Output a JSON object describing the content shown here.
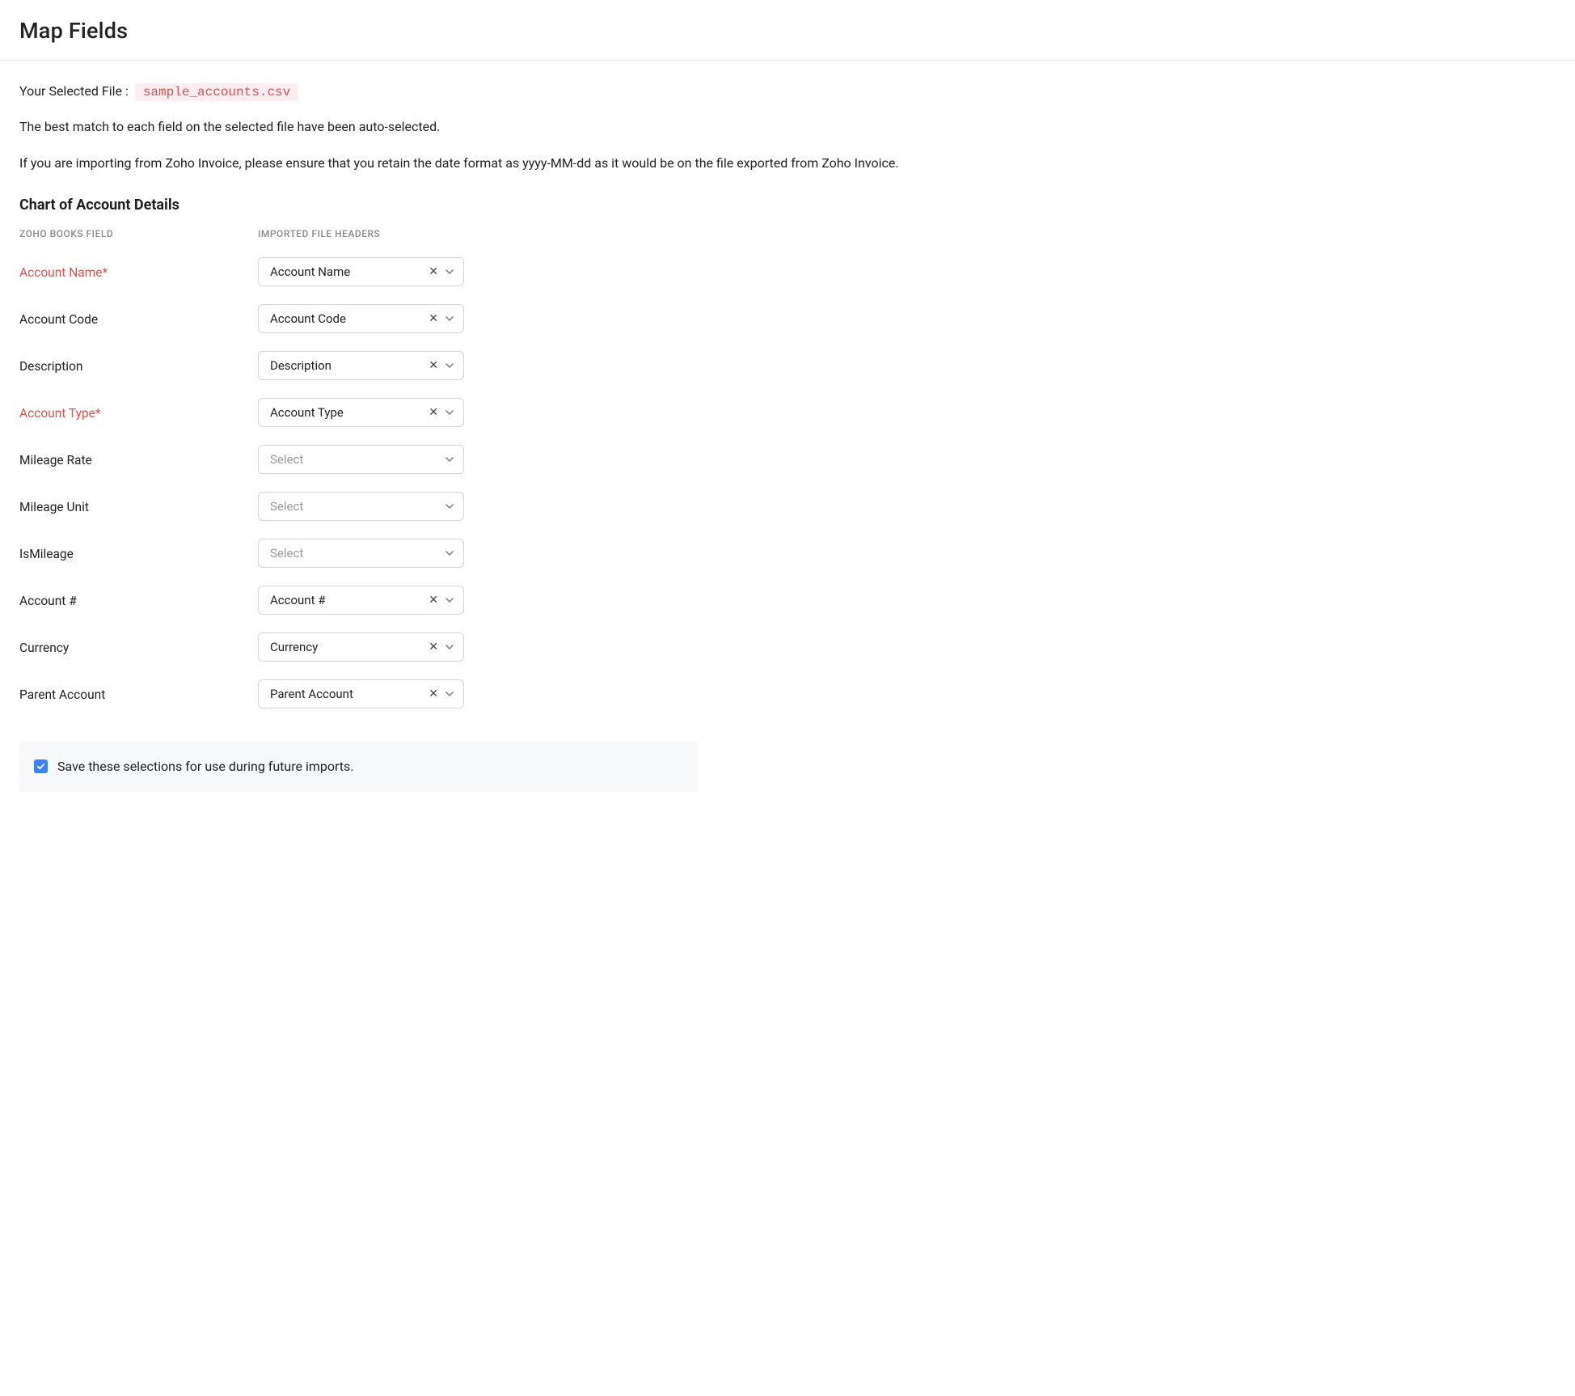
{
  "header": {
    "title": "Map Fields"
  },
  "file_line": {
    "label": "Your Selected File :",
    "filename": "sample_accounts.csv"
  },
  "info_para1": "The best match to each field on the selected file have been auto-selected.",
  "info_para2": "If you are importing from Zoho Invoice, please ensure that you retain the date format as yyyy-MM-dd as it would be on the file exported from Zoho Invoice.",
  "section_heading": "Chart of Account Details",
  "columns": {
    "zoho_field": "ZOHO BOOKS FIELD",
    "imported_header": "IMPORTED FILE HEADERS"
  },
  "placeholder_text": "Select",
  "rows": [
    {
      "label": "Account Name*",
      "required": true,
      "value": "Account Name",
      "has_value": true
    },
    {
      "label": "Account Code",
      "required": false,
      "value": "Account Code",
      "has_value": true
    },
    {
      "label": "Description",
      "required": false,
      "value": "Description",
      "has_value": true
    },
    {
      "label": "Account Type*",
      "required": true,
      "value": "Account Type",
      "has_value": true
    },
    {
      "label": "Mileage Rate",
      "required": false,
      "value": "",
      "has_value": false
    },
    {
      "label": "Mileage Unit",
      "required": false,
      "value": "",
      "has_value": false
    },
    {
      "label": "IsMileage",
      "required": false,
      "value": "",
      "has_value": false
    },
    {
      "label": "Account #",
      "required": false,
      "value": "Account #",
      "has_value": true
    },
    {
      "label": "Currency",
      "required": false,
      "value": "Currency",
      "has_value": true
    },
    {
      "label": "Parent Account",
      "required": false,
      "value": "Parent Account",
      "has_value": true
    }
  ],
  "save_selection": {
    "checked": true,
    "label": "Save these selections for use during future imports."
  }
}
